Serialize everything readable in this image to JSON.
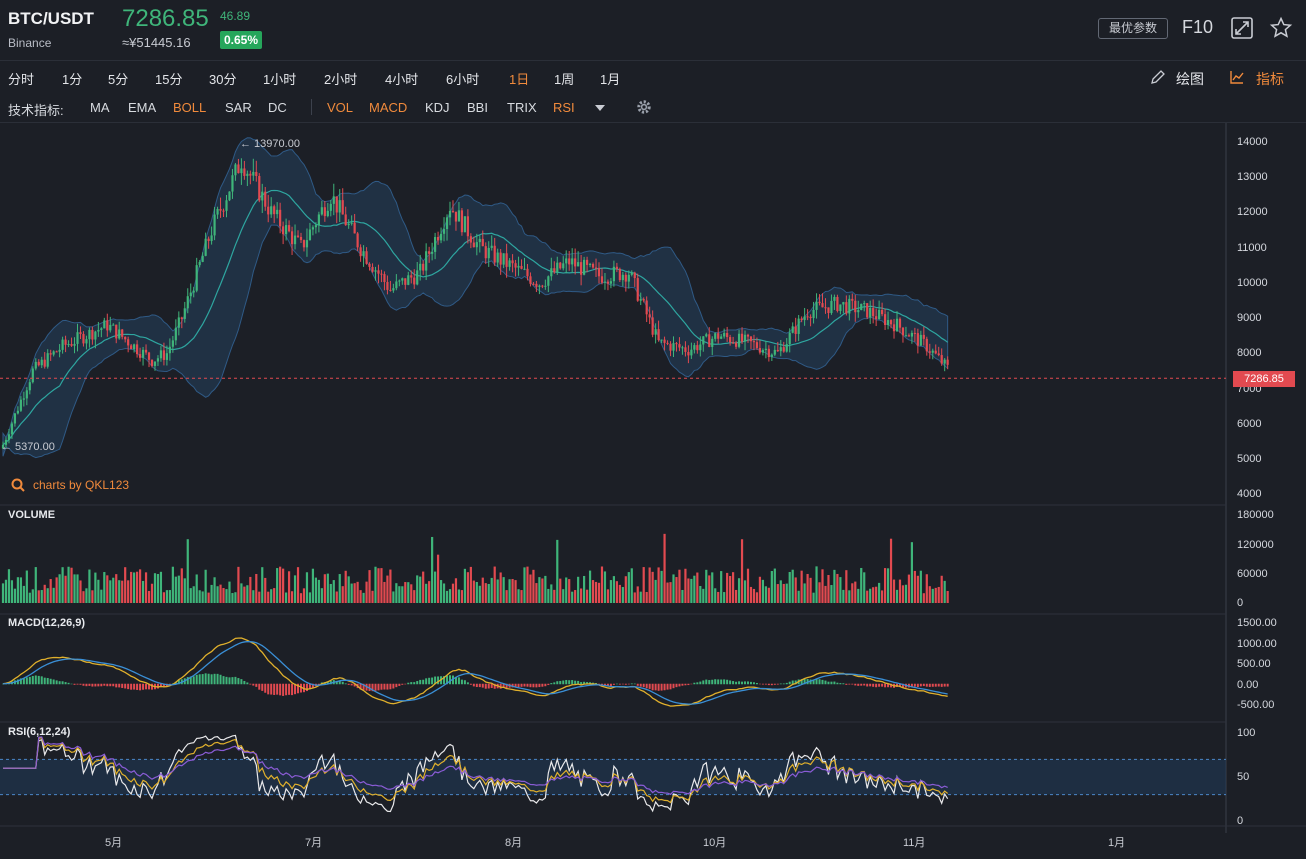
{
  "header": {
    "pair": "BTC/USDT",
    "exchange": "Binance",
    "price": "7286.85",
    "cny": "≈¥51445.16",
    "change": "46.89",
    "change_pct": "0.65%",
    "options_label": "最优参数",
    "f10_label": "F10",
    "icons": [
      "fullscreen-icon",
      "star-icon"
    ]
  },
  "timeframes": [
    {
      "label": "分时",
      "active": false
    },
    {
      "label": "1分",
      "active": false
    },
    {
      "label": "5分",
      "active": false
    },
    {
      "label": "15分",
      "active": false
    },
    {
      "label": "30分",
      "active": false
    },
    {
      "label": "1小时",
      "active": false
    },
    {
      "label": "2小时",
      "active": false
    },
    {
      "label": "4小时",
      "active": false
    },
    {
      "label": "6小时",
      "active": false
    },
    {
      "label": "1日",
      "active": true
    },
    {
      "label": "1周",
      "active": false
    },
    {
      "label": "1月",
      "active": false
    }
  ],
  "tools": {
    "draw_label": "绘图",
    "indicators_label": "指标"
  },
  "indicator_bar": {
    "title": "技术指标:",
    "main": [
      {
        "label": "MA",
        "active": false
      },
      {
        "label": "EMA",
        "active": false
      },
      {
        "label": "BOLL",
        "active": true
      },
      {
        "label": "SAR",
        "active": false
      },
      {
        "label": "DC",
        "active": false
      }
    ],
    "sub": [
      {
        "label": "VOL",
        "active": true
      },
      {
        "label": "MACD",
        "active": true
      },
      {
        "label": "KDJ",
        "active": false
      },
      {
        "label": "BBI",
        "active": false
      },
      {
        "label": "TRIX",
        "active": false
      },
      {
        "label": "RSI",
        "active": true
      }
    ]
  },
  "chart": {
    "brand": "charts by QKL123",
    "high_label": "13970.00",
    "low_label": "5370.00",
    "current_price_tag": "7286.85",
    "price_axis": [
      "14000",
      "13000",
      "12000",
      "11000",
      "10000",
      "9000",
      "8000",
      "7000",
      "6000",
      "5000",
      "4000"
    ],
    "volume_label": "VOLUME",
    "volume_axis": [
      "180000",
      "120000",
      "60000",
      "0"
    ],
    "macd_label": "MACD(12,26,9)",
    "macd_axis": [
      "1500.00",
      "1000.00",
      "500.00",
      "0.00",
      "-500.00"
    ],
    "rsi_label": "RSI(6,12,24)",
    "rsi_axis": [
      "100",
      "50",
      "0"
    ],
    "x_axis": [
      "5月",
      "7月",
      "8月",
      "10月",
      "11月",
      "1月"
    ],
    "colors": {
      "up": "#3fb57a",
      "down": "#e24a50",
      "accent": "#f08a3c",
      "band": "#25405c",
      "mid": "#2ea6a0"
    }
  },
  "chart_data": {
    "type": "candlestick",
    "price_series_anchors": {
      "index": [
        0,
        10,
        20,
        35,
        50,
        55,
        60,
        70,
        80,
        90,
        100,
        110,
        120,
        130,
        140,
        150,
        160,
        170,
        180,
        190,
        200,
        210,
        220,
        230,
        240,
        250,
        260,
        270,
        280,
        290,
        300,
        310,
        320,
        330,
        340,
        350,
        360,
        370,
        380,
        390,
        395
      ],
      "close": [
        5400,
        7500,
        8200,
        8800,
        7800,
        8000,
        9000,
        11500,
        13500,
        12000,
        11000,
        12500,
        11000,
        9800,
        10300,
        12200,
        11000,
        10500,
        10000,
        10600,
        10200,
        10300,
        8300,
        8100,
        8500,
        8300,
        8000,
        9200,
        9400,
        9200,
        8800,
        8200,
        7300,
        7500,
        7600,
        7300,
        7286.85,
        7286.85,
        7286.85,
        7286.85,
        7286.85
      ]
    },
    "high": 13970,
    "low": 5370,
    "last": 7286.85,
    "price_ylim": [
      4000,
      14000
    ],
    "volume_ylim": [
      0,
      180000
    ],
    "macd_ylim": [
      -500,
      1500
    ],
    "rsi_ylim": [
      0,
      100
    ],
    "rsi_bands": [
      30,
      70
    ]
  }
}
